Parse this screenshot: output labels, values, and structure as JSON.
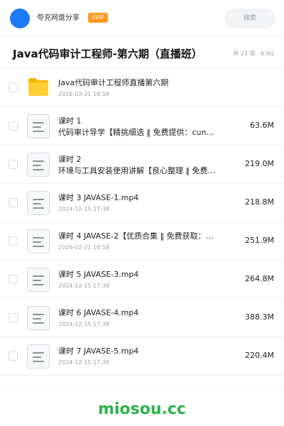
{
  "topbar": {
    "share_name": "夸克网盘分享",
    "badge": "SVIP",
    "search_label": "搜索",
    "avatar_color": "#1e7bf5",
    "badge_color": "#ff9a1e"
  },
  "header": {
    "title": "Java代码审计工程师-第六期（直播班）",
    "meta": "共 23 项 · 6.6G"
  },
  "files": [
    {
      "type": "folder",
      "name": "Java代码审计工程师直播第六期",
      "date": "2026-02-21 16:58",
      "subtitle": null,
      "size": null
    },
    {
      "type": "doc",
      "name": "课时 1",
      "date": null,
      "subtitle": "代码审计导学【精挑细选 ‖ 免费提供：cun…",
      "size": "63.6M"
    },
    {
      "type": "doc",
      "name": "课时 2",
      "date": null,
      "subtitle": "环境与工具安装使用讲解【良心整理 ‖ 免费…",
      "size": "219.0M"
    },
    {
      "type": "doc",
      "name": "课时 3  JAVASE-1.mp4",
      "date": "2024-12-15 17:38",
      "subtitle": null,
      "size": "218.8M"
    },
    {
      "type": "doc",
      "name": "课时 4  JAVASE-2【优质合集 ‖ 免费获取：…",
      "date": "2026-02-21 16:58",
      "subtitle": null,
      "size": "251.9M"
    },
    {
      "type": "doc",
      "name": "课时 5  JAVASE-3.mp4",
      "date": "2024-12-15 17:38",
      "subtitle": null,
      "size": "264.8M"
    },
    {
      "type": "doc",
      "name": "课时 6  JAVASE-4.mp4",
      "date": "2024-12-15 17:38",
      "subtitle": null,
      "size": "388.3M"
    },
    {
      "type": "doc",
      "name": "课时 7  JAVASE-5.mp4",
      "date": "2024-12-15 17:38",
      "subtitle": null,
      "size": "220.4M"
    }
  ],
  "footer": {
    "watermark": "miosou.cc",
    "watermark_color": "#2db24a"
  }
}
